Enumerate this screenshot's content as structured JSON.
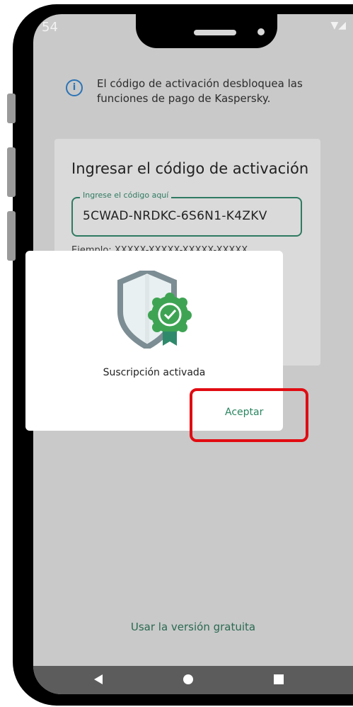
{
  "status_bar": {
    "time": "54",
    "right_icons": "▼◢"
  },
  "info": {
    "icon": "i",
    "text": "El código de activación desbloquea las funciones de pago de Kaspersky."
  },
  "card": {
    "title": "Ingresar el código de activación",
    "field_label": "Ingrese el código aquí",
    "field_value": "5CWAD-NRDKC-6S6N1-K4ZKV",
    "example": "Ejemplo: XXXXX-XXXXX-XXXXX-XXXXX"
  },
  "dialog": {
    "message": "Suscripción activada",
    "accept_label": "Aceptar"
  },
  "free_version_label": "Usar la versión gratuita",
  "colors": {
    "accent_green": "#2a8560",
    "highlight_red": "#e10c12",
    "info_blue": "#2c74b6"
  }
}
